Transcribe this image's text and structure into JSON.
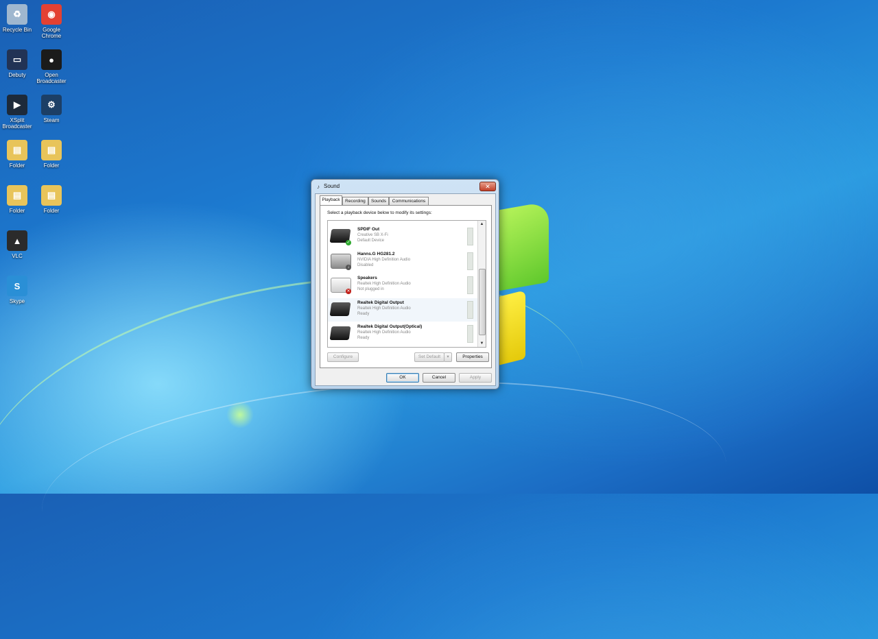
{
  "desktop": {
    "icons": [
      {
        "label": "Recycle Bin",
        "icon": "recycle-bin-icon",
        "color": "#9fb7cf"
      },
      {
        "label": "Google Chrome",
        "icon": "chrome-icon",
        "color": "#e34133"
      },
      {
        "label": "Debuty",
        "icon": "monitor-icon",
        "color": "#223355"
      },
      {
        "label": "Open Broadcaster",
        "icon": "obs-icon",
        "color": "#1b1b1b"
      },
      {
        "label": "XSplit Broadcaster",
        "icon": "xsplit-icon",
        "color": "#1d2a3a"
      },
      {
        "label": "Steam",
        "icon": "steam-icon",
        "color": "#1c3f66"
      },
      {
        "label": "Folder",
        "icon": "folder-icon",
        "color": "#e8c45a"
      },
      {
        "label": "Folder",
        "icon": "folder-icon",
        "color": "#e8c45a"
      },
      {
        "label": "Folder",
        "icon": "folder-icon",
        "color": "#e8c45a"
      },
      {
        "label": "Folder",
        "icon": "folder-icon",
        "color": "#e8c45a"
      },
      {
        "label": "VLC",
        "icon": "vlc-icon",
        "color": "#2b2b2b"
      },
      {
        "label": "Skype",
        "icon": "skype-icon",
        "color": "#2a8fd6"
      }
    ]
  },
  "dialog": {
    "title": "Sound",
    "close_symbol": "✕",
    "tabs": [
      "Playback",
      "Recording",
      "Sounds",
      "Communications"
    ],
    "active_tab": "Playback",
    "instruction": "Select a playback device below to modify its settings:",
    "devices": [
      {
        "name": "SPDIF Out",
        "line1": "Creative SB X-Fi",
        "line2": "Default Device",
        "icon": "spdif-device-icon",
        "status_icon": "default-check-icon"
      },
      {
        "name": "Hanns.G HG281.2",
        "line1": "NVIDIA High Definition Audio",
        "line2": "Disabled",
        "icon": "monitor-speaker-icon",
        "status_icon": "disabled-down-icon"
      },
      {
        "name": "Speakers",
        "line1": "Realtek High Definition Audio",
        "line2": "Not plugged in",
        "icon": "speakers-icon",
        "status_icon": "unplugged-icon"
      },
      {
        "name": "Realtek Digital Output",
        "line1": "Realtek High Definition Audio",
        "line2": "Ready",
        "icon": "digital-output-icon",
        "status_icon": ""
      },
      {
        "name": "Realtek Digital Output(Optical)",
        "line1": "Realtek High Definition Audio",
        "line2": "Ready",
        "icon": "optical-output-icon",
        "status_icon": ""
      }
    ],
    "buttons": {
      "configure": "Configure",
      "set_default": "Set Default",
      "properties": "Properties",
      "ok": "OK",
      "cancel": "Cancel",
      "apply": "Apply"
    }
  }
}
